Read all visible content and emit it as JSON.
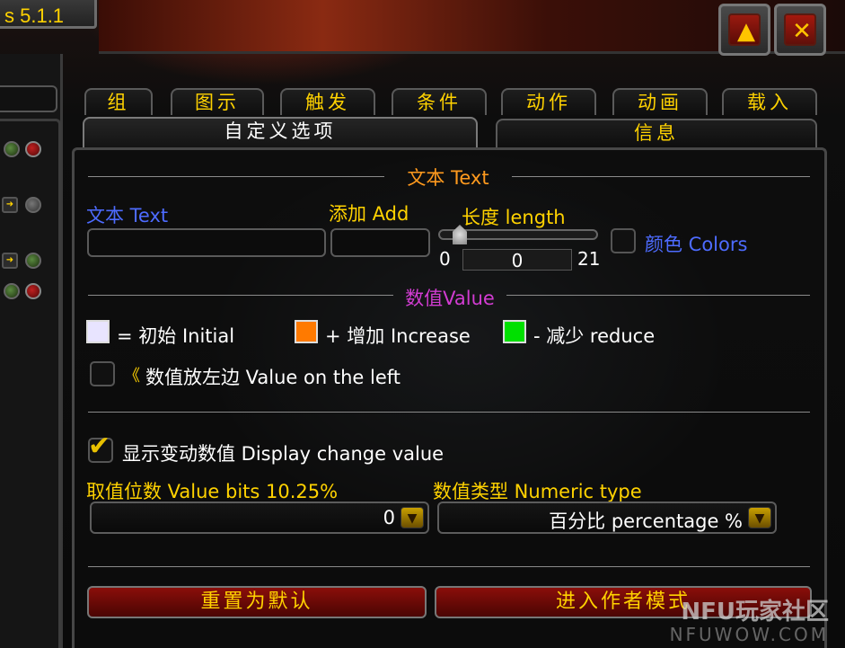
{
  "window": {
    "version": "s 5.1.1"
  },
  "top_buttons": {
    "collapse_glyph": "▲",
    "close_glyph": "✕"
  },
  "tabs_row1": [
    "组",
    "图示",
    "触发",
    "条件",
    "动作",
    "动画",
    "载入"
  ],
  "tabs_row2": [
    "自定义选项",
    "信息"
  ],
  "text_section": {
    "title": "文本 Text",
    "text_label": "文本 Text",
    "text_value": "",
    "add_label": "添加 Add",
    "add_value": "",
    "length_label": "长度 length",
    "length_min": "0",
    "length_max": "21",
    "length_value": "0",
    "length_fraction": 0.15,
    "colors_label": "颜色 Colors"
  },
  "value_section": {
    "title": "数值Value",
    "initial_label": "= 初始 Initial",
    "increase_label": "+ 增加 Increase",
    "reduce_label": "- 减少 reduce",
    "initial_color": "#e8e4ff",
    "increase_color": "#ff7a00",
    "reduce_color": "#00e000",
    "left_glyph": "《",
    "left_label": "数值放左边 Value on the left"
  },
  "display_change": {
    "label": "显示变动数值 Display change value",
    "checked": true
  },
  "value_bits": {
    "label": "取值位数 Value bits 10.25%",
    "value": "0"
  },
  "numeric_type": {
    "label": "数值类型 Numeric type",
    "value": "百分比 percentage %"
  },
  "buttons": {
    "reset": "重置为默认",
    "author_mode": "进入作者模式"
  },
  "watermark": {
    "line1": "NFU玩家社区",
    "line2": "NFUWOW.COM"
  },
  "colors": {
    "gold": "#ffd200",
    "blue": "#4d6bff",
    "magenta": "#d23cd2",
    "button_red": "#8a0e0a"
  }
}
